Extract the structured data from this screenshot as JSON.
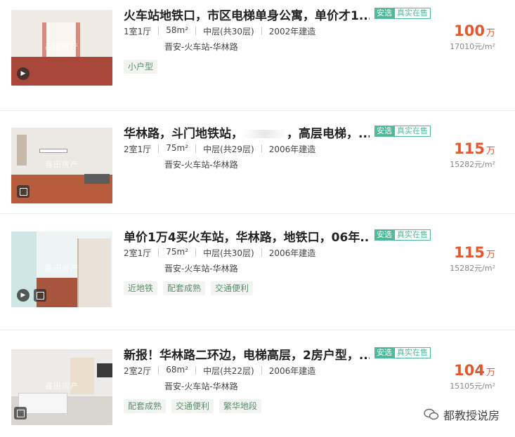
{
  "listings": [
    {
      "title": "火车站地铁口，市区电梯单身公寓，单价才1...",
      "tag_anxuan": "安选",
      "tag_verified": "真实在售",
      "layout": "1室1厅",
      "area": "58m²",
      "floor": "中层(共30层)",
      "year": "2002年建造",
      "location": "晋安-火车站-华林路",
      "labels": [
        "小户型"
      ],
      "price": "100",
      "price_unit": "万",
      "unit_price": "17010元/m²",
      "watermark": "鑫田房产"
    },
    {
      "title_part1": "华林路，斗门地铁站，",
      "title_part2": "，高层电梯，...",
      "tag_anxuan": "安选",
      "tag_verified": "真实在售",
      "layout": "2室1厅",
      "area": "75m²",
      "floor": "中层(共29层)",
      "year": "2006年建造",
      "location": "晋安-火车站-华林路",
      "labels": [],
      "price": "115",
      "price_unit": "万",
      "unit_price": "15282元/m²",
      "watermark": "鑫田房产"
    },
    {
      "title": "单价1万4买火车站，华林路，地铁口，06年...",
      "tag_anxuan": "安选",
      "tag_verified": "真实在售",
      "layout": "2室1厅",
      "area": "75m²",
      "floor": "中层(共30层)",
      "year": "2006年建造",
      "location": "晋安-火车站-华林路",
      "labels": [
        "近地铁",
        "配套成熟",
        "交通便利"
      ],
      "price": "115",
      "price_unit": "万",
      "unit_price": "15282元/m²",
      "watermark": "鑫田房产"
    },
    {
      "title": "新报！华林路二环边，电梯高层，2房户型，...",
      "tag_anxuan": "安选",
      "tag_verified": "真实在售",
      "layout": "2室2厅",
      "area": "68m²",
      "floor": "中层(共22层)",
      "year": "2006年建造",
      "location": "晋安-火车站-华林路",
      "labels": [
        "配套成熟",
        "交通便利",
        "繁华地段"
      ],
      "price": "104",
      "price_unit": "万",
      "unit_price": "15105元/m²",
      "watermark": "鑫田房产"
    }
  ],
  "brand": {
    "name": "都教授说房"
  },
  "colors": {
    "accent_green": "#4fb99a",
    "price_orange": "#e4572e"
  }
}
